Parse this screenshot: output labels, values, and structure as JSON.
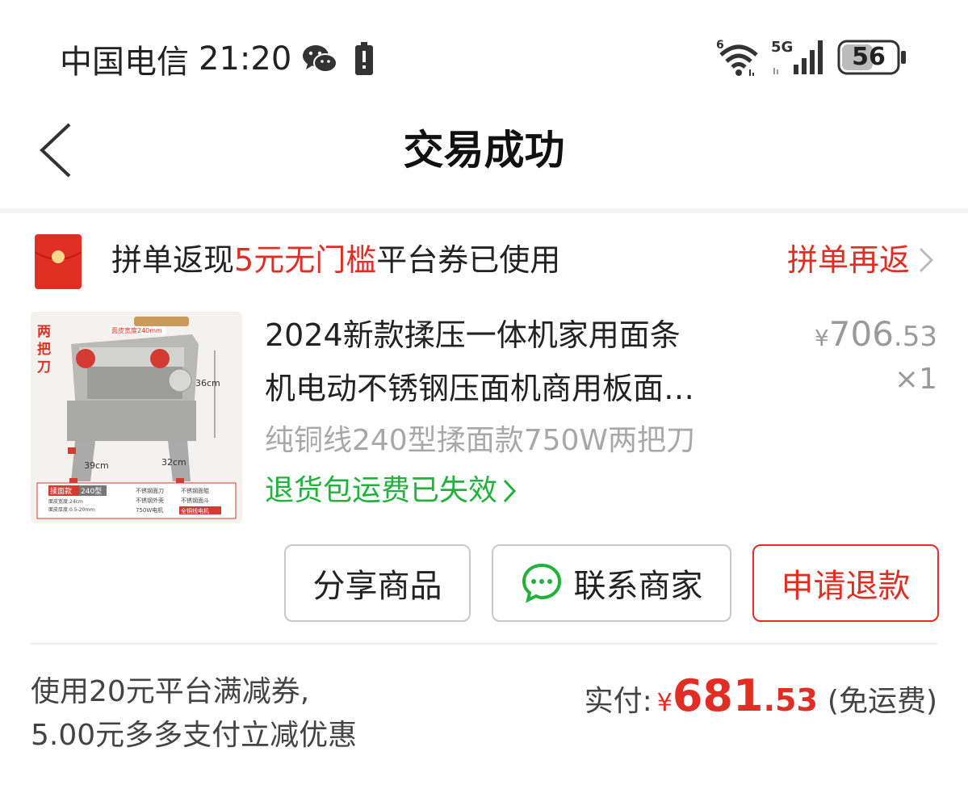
{
  "status_bar": {
    "carrier": "中国电信",
    "time": "21:20",
    "wifi_label": "6",
    "network_label": "5G",
    "battery": "56"
  },
  "header": {
    "title": "交易成功"
  },
  "banner": {
    "text_prefix": "拼单返现",
    "text_highlight": "5元无门槛",
    "text_suffix": "平台券已使用",
    "link": "拼单再返"
  },
  "product": {
    "title_line1": "2024新款揉压一体机家用面条",
    "title_line2": "机电动不锈钢压面机商用板面…",
    "spec": "纯铜线240型揉面款750W两把刀",
    "return_info": "退货包运费已失效",
    "price_currency": "¥",
    "price_int": "706",
    "price_dec": ".53",
    "quantity": "×1",
    "image_labels": {
      "badge": "两把刀",
      "width_tag": "面皮宽度240mm",
      "height": "36cm",
      "depth": "39cm",
      "width": "32cm",
      "model_tag": "揉面款",
      "model_num": "240型",
      "feature1": "不锈钢面刀",
      "feature2": "不锈钢面辊",
      "feature3": "不锈钢外壳",
      "feature4": "不锈钢面斗",
      "feature5": "750W电机",
      "feature6": "全铜线电机",
      "spec1": "面皮宽度:24cm",
      "spec2": "面皮厚度:0.5-20mm"
    }
  },
  "actions": {
    "share": "分享商品",
    "contact": "联系商家",
    "refund": "申请退款"
  },
  "summary": {
    "discount_line1": "使用20元平台满减券,",
    "discount_line2": "5.00元多多支付立减优惠",
    "paid_label": "实付:",
    "paid_currency": "¥",
    "paid_int": "681",
    "paid_dec": ".53",
    "shipping_note": "(免运费)"
  },
  "colors": {
    "accent_red": "#e02e24",
    "green": "#21b23c",
    "gray_text": "#a8a8a8"
  },
  "icons": [
    "wechat-icon",
    "battery-icon",
    "wifi-icon",
    "signal-icon",
    "back-icon",
    "red-packet-icon",
    "chevron-right-icon",
    "chat-icon"
  ]
}
